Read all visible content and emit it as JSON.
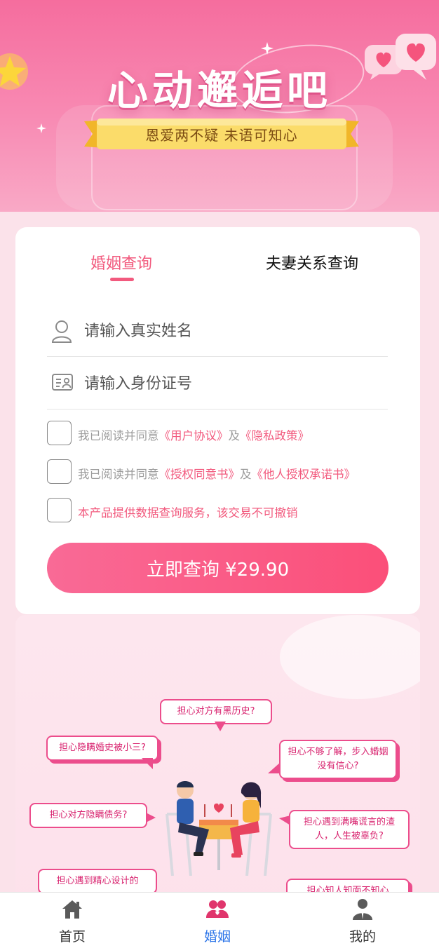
{
  "banner": {
    "title": "心动邂逅吧",
    "ribbon_text": "恩爱两不疑   未语可知心"
  },
  "tabs": [
    {
      "label": "婚姻查询",
      "active": true
    },
    {
      "label": "夫妻关系查询",
      "active": false
    }
  ],
  "form": {
    "name_placeholder": "请输入真实姓名",
    "id_placeholder": "请输入身份证号",
    "agreements": [
      {
        "prefix": "我已阅读并同意",
        "link1": "《用户协议》",
        "joiner": "及",
        "link2": "《隐私政策》"
      },
      {
        "prefix": "我已阅读并同意",
        "link1": "《授权同意书》",
        "joiner": "及",
        "link2": "《他人授权承诺书》"
      }
    ],
    "notice": "本产品提供数据查询服务，该交易不可撤销",
    "submit_label": "立即查询 ¥29.90"
  },
  "illustration": {
    "bubbles": [
      "担心对方有黑历史?",
      "担心隐瞒婚史被小三?",
      "担心不够了解，步入婚姻没有信心?",
      "担心对方隐瞒债务?",
      "担心遇到满嘴谎言的渣人，人生被辜负?",
      "担心遇到精心设计的",
      "担心知人知面不知心"
    ]
  },
  "bottom_nav": [
    {
      "label": "首页",
      "icon": "home-icon",
      "active": false
    },
    {
      "label": "婚姻",
      "icon": "couple-icon",
      "active": true
    },
    {
      "label": "我的",
      "icon": "user-icon",
      "active": false
    }
  ],
  "colors": {
    "accent": "#f25a7e",
    "nav_active": "#2b74e8",
    "banner_top": "#f56d9e"
  }
}
